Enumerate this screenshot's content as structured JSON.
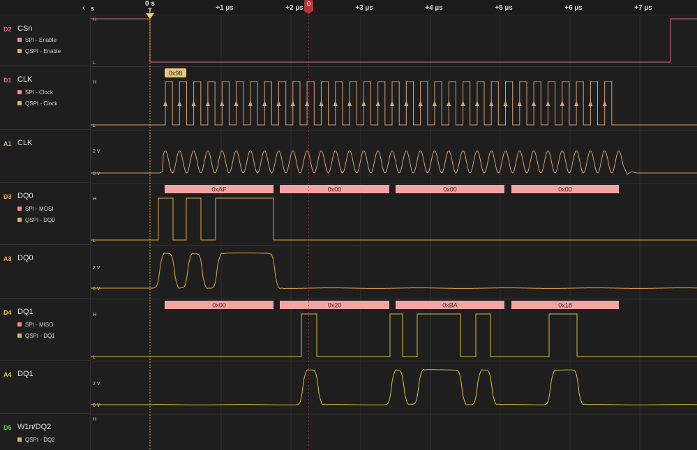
{
  "ruler": {
    "collapse_icon": "chevron-left-icon",
    "left_unit": "s",
    "zero_label": "0 s",
    "trigger_letter": "T",
    "cursor_label": "0",
    "ticks": [
      "+1 µs",
      "+2 µs",
      "+3 µs",
      "+4 µs",
      "+5 µs",
      "+6 µs",
      "+7 µs"
    ]
  },
  "colors": {
    "background": "#1e1e1e",
    "grid": "#2f2f2f",
    "trigger": "#f0d84a",
    "cursor": "#b3363e",
    "csn": "#e8607a",
    "clk": "#d9a070",
    "dq0": "#e7a53a",
    "dq1": "#d8c431",
    "w1n": "#52c45f",
    "decode_box": "#f4a3a3",
    "decode_text": "#3a1f1f",
    "label_badge": "#e6c77a",
    "spi_dot": "#f08c8c",
    "qspi_dot": "#d9b26a"
  },
  "channels": [
    {
      "id": "D2",
      "name": "CSn",
      "type": "digital",
      "decoders": [
        "SPI - Enable",
        "QSPI - Enable"
      ],
      "levels": [
        "H",
        "L"
      ]
    },
    {
      "id": "D1",
      "name": "CLK",
      "type": "digital",
      "decoders": [
        "SPI - Clock",
        "QSPI - Clock"
      ],
      "levels": [
        "H",
        "L"
      ],
      "badge": "0x98"
    },
    {
      "id": "A1",
      "name": "CLK",
      "type": "analog",
      "decoders": [],
      "levels": [
        "2 V",
        "0 V"
      ]
    },
    {
      "id": "D3",
      "name": "DQ0",
      "type": "digital",
      "decoders": [
        "SPI - MOSI",
        "QSPI - DQ0"
      ],
      "levels": [
        "H",
        "L"
      ],
      "bytes": [
        "0xAF",
        "0x00",
        "0x00",
        "0x00"
      ]
    },
    {
      "id": "A3",
      "name": "DQ0",
      "type": "analog",
      "decoders": [],
      "levels": [
        "2 V",
        "0 V"
      ]
    },
    {
      "id": "D4",
      "name": "DQ1",
      "type": "digital",
      "decoders": [
        "SPI - MISO",
        "QSPI - DQ1"
      ],
      "levels": [
        "H",
        "L"
      ],
      "bytes": [
        "0x00",
        "0x20",
        "0xBA",
        "0x18"
      ]
    },
    {
      "id": "A4",
      "name": "DQ1",
      "type": "analog",
      "decoders": [],
      "levels": [
        "2 V",
        "0 V"
      ]
    },
    {
      "id": "D5",
      "name": "W1n/DQ2",
      "type": "digital",
      "decoders": [
        "QSPI - DQ2"
      ],
      "levels": [
        "H"
      ]
    }
  ]
}
